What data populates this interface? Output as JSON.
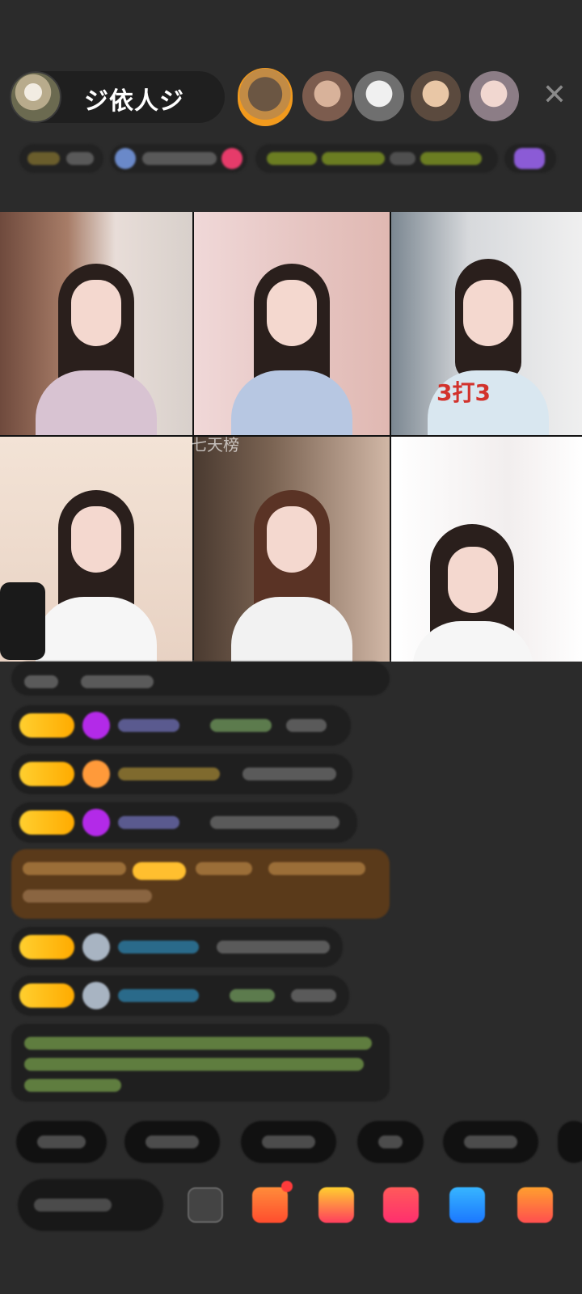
{
  "header": {
    "host_name": "ジ依人ジ",
    "close_icon": "✕"
  },
  "grid": {
    "watermark": "七天榜",
    "label_3v3": "3打3"
  },
  "colors": {
    "accent_yellow": "#ffbf00",
    "accent_green": "#7cd45a",
    "accent_blue": "#36b6ff",
    "brown_message_bg": "#5a3a1a"
  }
}
